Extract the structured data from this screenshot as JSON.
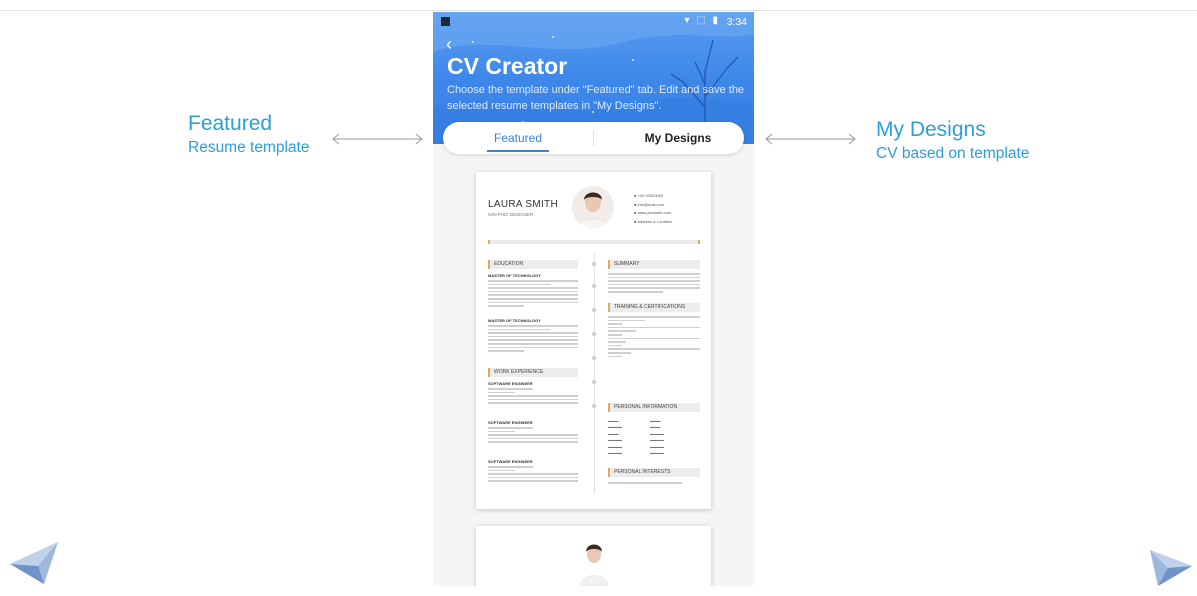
{
  "left_annotation": {
    "title": "Featured",
    "subtitle": "Resume template"
  },
  "right_annotation": {
    "title": "My Designs",
    "subtitle": "CV based on template"
  },
  "status_bar": {
    "time": "3:34",
    "icons": "▾ ⬚ ▮"
  },
  "app": {
    "back_glyph": "‹",
    "title": "CV Creator",
    "description": "Choose the template under \"Featured\" tab. Edit and save the selected resume templates in \"My Designs\"."
  },
  "tabs": [
    {
      "label": "Featured",
      "active": true
    },
    {
      "label": "My Designs",
      "active": false
    }
  ],
  "resume": {
    "name": "LAURA SMITH",
    "role": "GRAPHIC DESIGNER",
    "contact": [
      "+00 00000000",
      "info@mail.com",
      "www.yourweb.com",
      "Address & Location"
    ],
    "left_sections": {
      "education": "EDUCATION",
      "edu_item_1": "MASTER OF TECHNOLOGY",
      "edu_item_2": "MASTER OF TECHNOLOGY",
      "work": "WORK EXPERIENCE",
      "work_item_1": "SOFTWARE ENGINEER",
      "work_item_2": "SOFTWARE ENGINEER",
      "work_item_3": "SOFTWARE ENGINEER"
    },
    "right_sections": {
      "summary": "SUMMARY",
      "training": "TRAINING & CERTIFICATIONS",
      "personal": "PERSONAL INFORMATION",
      "interests": "PERSONAL INTERESTS"
    }
  },
  "colors": {
    "accent": "#2a9fd8",
    "header_blue": "#3c86ea",
    "resume_gold": "#d8ad64"
  },
  "icons": {
    "prev": "paper-plane-left-icon",
    "next": "paper-plane-right-icon"
  }
}
